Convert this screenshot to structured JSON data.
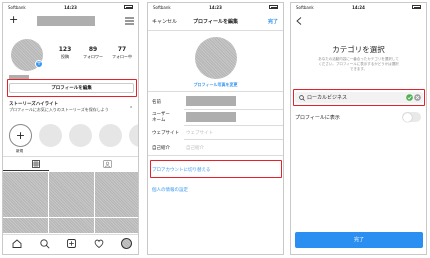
{
  "p1": {
    "carrier": "Softbank",
    "time": "14:23",
    "stats": [
      {
        "num": "123",
        "label": "投稿"
      },
      {
        "num": "89",
        "label": "フォロワー"
      },
      {
        "num": "77",
        "label": "フォロー中"
      }
    ],
    "edit_profile": "プロフィールを編集",
    "highlights_title": "ストーリーズハイライト",
    "highlights_desc": "プロフィールにお気に入りのストーリーズを保存しよう",
    "new_label": "新規"
  },
  "p2": {
    "carrier": "Softbank",
    "time": "14:23",
    "cancel": "キャンセル",
    "title": "プロフィールを編集",
    "done": "完了",
    "change_photo": "プロフィール写真を変更",
    "fields": [
      {
        "label": "名前",
        "value": ""
      },
      {
        "label": "ユーザー\nネーム",
        "value": ""
      },
      {
        "label": "ウェブサイト",
        "value": "ウェブサイト"
      },
      {
        "label": "自己紹介",
        "value": "自己紹介"
      }
    ],
    "switch_pro": "プロアカウントに切り替える",
    "personal_info": "個人の情報の設定"
  },
  "p3": {
    "carrier": "Softbank",
    "time": "14:24",
    "heading": "カテゴリを選択",
    "desc1": "あなたの活動内容に一番合ったカテゴリを選択して",
    "desc2": "ください。プロフィールに表示するかどうかは選択",
    "desc3": "できます。",
    "search_value": "ローカルビジネス",
    "show_on_profile": "プロフィールに表示",
    "done": "完了"
  },
  "colors": {
    "red": "#e8202a",
    "blue": "#2a8ff0",
    "link": "#3897f0",
    "green": "#4caf50"
  }
}
